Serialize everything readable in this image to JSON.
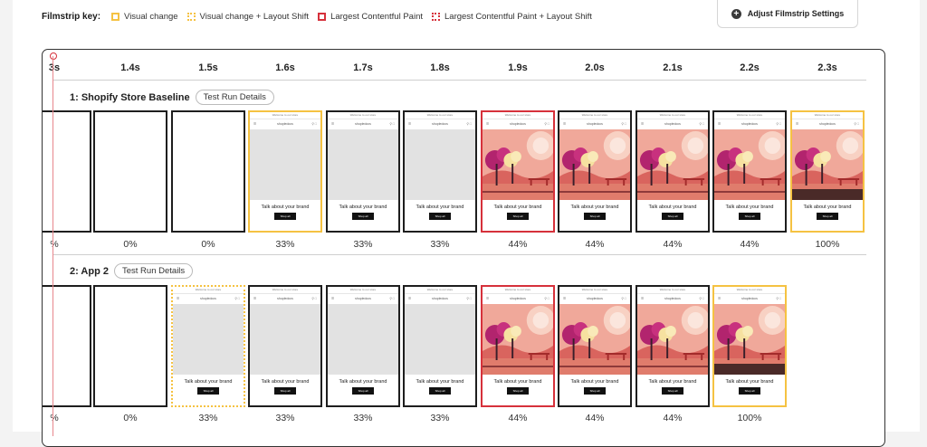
{
  "key": {
    "label": "Filmstrip key:",
    "items": [
      {
        "text": "Visual change",
        "style": "vc"
      },
      {
        "text": "Visual change + Layout Shift",
        "style": "vcl"
      },
      {
        "text": "Largest Contentful Paint",
        "style": "lcp"
      },
      {
        "text": "Largest Contentful Paint + Layout Shift",
        "style": "lcpl"
      }
    ],
    "colors": {
      "visual_change": "#f5c242",
      "lcp": "#d6313b"
    }
  },
  "adjust_button": {
    "label": "Adjust Filmstrip Settings",
    "icon": "plus-icon"
  },
  "timeline": [
    "3s",
    "1.4s",
    "1.5s",
    "1.6s",
    "1.7s",
    "1.8s",
    "1.9s",
    "2.0s",
    "2.1s",
    "2.2s",
    "2.3s"
  ],
  "frame_text": {
    "top_bar": "Welcome to our store",
    "logo": "shopledocs",
    "brand": "Talk about your brand",
    "button": "Shop all"
  },
  "rows": [
    {
      "title": "1: Shopify Store Baseline",
      "details_label": "Test Run Details",
      "frames": [
        {
          "pct": "%",
          "style": "black",
          "kind": "blank"
        },
        {
          "pct": "0%",
          "style": "black",
          "kind": "blank"
        },
        {
          "pct": "0%",
          "style": "black",
          "kind": "blank"
        },
        {
          "pct": "33%",
          "style": "vc",
          "kind": "gray"
        },
        {
          "pct": "33%",
          "style": "black",
          "kind": "gray"
        },
        {
          "pct": "33%",
          "style": "black",
          "kind": "gray"
        },
        {
          "pct": "44%",
          "style": "lcp",
          "kind": "art"
        },
        {
          "pct": "44%",
          "style": "black",
          "kind": "art"
        },
        {
          "pct": "44%",
          "style": "black",
          "kind": "art"
        },
        {
          "pct": "44%",
          "style": "black",
          "kind": "art"
        },
        {
          "pct": "100%",
          "style": "vc",
          "kind": "full"
        }
      ]
    },
    {
      "title": "2: App 2",
      "details_label": "Test Run Details",
      "frames": [
        {
          "pct": "%",
          "style": "black",
          "kind": "blank"
        },
        {
          "pct": "0%",
          "style": "black",
          "kind": "blank"
        },
        {
          "pct": "33%",
          "style": "vcl",
          "kind": "gray"
        },
        {
          "pct": "33%",
          "style": "black",
          "kind": "gray"
        },
        {
          "pct": "33%",
          "style": "black",
          "kind": "gray"
        },
        {
          "pct": "33%",
          "style": "black",
          "kind": "gray"
        },
        {
          "pct": "44%",
          "style": "lcp",
          "kind": "art"
        },
        {
          "pct": "44%",
          "style": "black",
          "kind": "art"
        },
        {
          "pct": "44%",
          "style": "black",
          "kind": "art"
        },
        {
          "pct": "100%",
          "style": "vc",
          "kind": "full"
        }
      ]
    }
  ]
}
